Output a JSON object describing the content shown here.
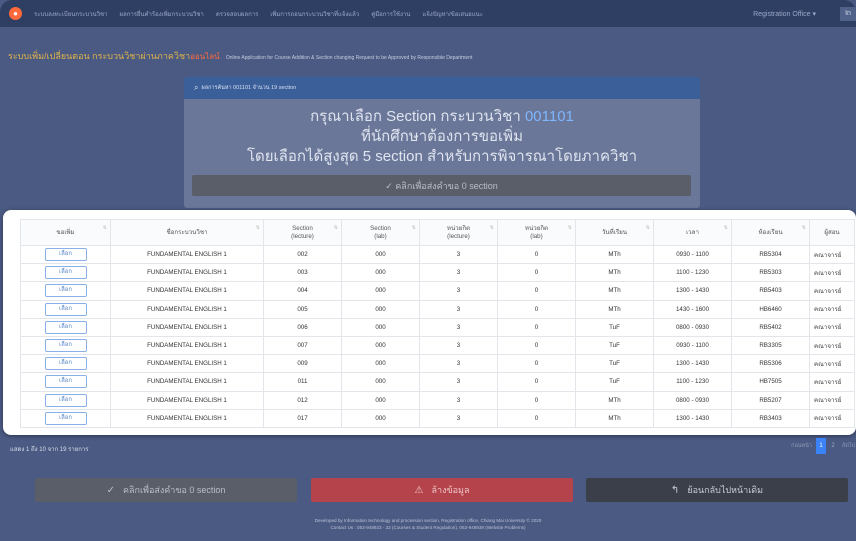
{
  "nav": {
    "items": [
      "ระบบลงทะเบียนกระบวนวิชา",
      "ผลการยื่นคำร้องเพิ่มกระบวนวิชา",
      "ตรวจสอบผลการ",
      "เพิ่มการถอนกระบวนวิชาที่แจ้งแล้ว",
      "คู่มือการใช้งาน",
      "แจ้งปัญหา/ข้อเสนอแนะ"
    ],
    "right_label": "Registration Office ▾",
    "right_box": "In"
  },
  "subtitle": {
    "main": "ระบบเพิ่ม/เปลี่ยนตอน กระบวนวิชาผ่านภาควิชา",
    "highlight": "ออนไลน์",
    "english": "Online Application for Course Addition & Section changing Request to be Approved by Responsible Department"
  },
  "card": {
    "header": "ผลการค้นหา 001101 จำนวน 19 section",
    "line1_prefix": "กรุณาเลือก Section กระบวนวิชา",
    "course_code": "001101",
    "line2": "ที่นักศึกษาต้องการขอเพิ่ม",
    "line3": "โดยเลือกได้สูงสุด 5 section สำหรับการพิจารณาโดยภาควิชา",
    "button": "✓ คลิกเพื่อส่งคำขอ 0 section"
  },
  "table": {
    "headers": [
      "ขอเพิ่ม",
      "ชื่อกระบวนวิชา",
      "Section\n(lecture)",
      "Section\n(lab)",
      "หน่วยกิต\n(lecture)",
      "หน่วยกิต\n(lab)",
      "วันที่เรียน",
      "เวลา",
      "ห้องเรียน",
      "ผู้สอน"
    ],
    "pick_label": "เลือก",
    "rows": [
      {
        "course": "FUNDAMENTAL ENGLISH 1",
        "sec_lec": "002",
        "sec_lab": "000",
        "cr_lec": "3",
        "cr_lab": "0",
        "day": "MTh",
        "time": "0930 - 1100",
        "room": "RB5304",
        "instr": "คณาจารย์"
      },
      {
        "course": "FUNDAMENTAL ENGLISH 1",
        "sec_lec": "003",
        "sec_lab": "000",
        "cr_lec": "3",
        "cr_lab": "0",
        "day": "MTh",
        "time": "1100 - 1230",
        "room": "RB5303",
        "instr": "คณาจารย์"
      },
      {
        "course": "FUNDAMENTAL ENGLISH 1",
        "sec_lec": "004",
        "sec_lab": "000",
        "cr_lec": "3",
        "cr_lab": "0",
        "day": "MTh",
        "time": "1300 - 1430",
        "room": "RB5403",
        "instr": "คณาจารย์"
      },
      {
        "course": "FUNDAMENTAL ENGLISH 1",
        "sec_lec": "005",
        "sec_lab": "000",
        "cr_lec": "3",
        "cr_lab": "0",
        "day": "MTh",
        "time": "1430 - 1600",
        "room": "HB6460",
        "instr": "คณาจารย์"
      },
      {
        "course": "FUNDAMENTAL ENGLISH 1",
        "sec_lec": "006",
        "sec_lab": "000",
        "cr_lec": "3",
        "cr_lab": "0",
        "day": "TuF",
        "time": "0800 - 0930",
        "room": "RB5402",
        "instr": "คณาจารย์"
      },
      {
        "course": "FUNDAMENTAL ENGLISH 1",
        "sec_lec": "007",
        "sec_lab": "000",
        "cr_lec": "3",
        "cr_lab": "0",
        "day": "TuF",
        "time": "0930 - 1100",
        "room": "RB3305",
        "instr": "คณาจารย์"
      },
      {
        "course": "FUNDAMENTAL ENGLISH 1",
        "sec_lec": "009",
        "sec_lab": "000",
        "cr_lec": "3",
        "cr_lab": "0",
        "day": "TuF",
        "time": "1300 - 1430",
        "room": "RB5306",
        "instr": "คณาจารย์"
      },
      {
        "course": "FUNDAMENTAL ENGLISH 1",
        "sec_lec": "011",
        "sec_lab": "000",
        "cr_lec": "3",
        "cr_lab": "0",
        "day": "TuF",
        "time": "1100 - 1230",
        "room": "HB7505",
        "instr": "คณาจารย์"
      },
      {
        "course": "FUNDAMENTAL ENGLISH 1",
        "sec_lec": "012",
        "sec_lab": "000",
        "cr_lec": "3",
        "cr_lab": "0",
        "day": "MTh",
        "time": "0800 - 0930",
        "room": "RB5207",
        "instr": "คณาจารย์"
      },
      {
        "course": "FUNDAMENTAL ENGLISH 1",
        "sec_lec": "017",
        "sec_lab": "000",
        "cr_lec": "3",
        "cr_lab": "0",
        "day": "MTh",
        "time": "1300 - 1430",
        "room": "RB3403",
        "instr": "คณาจารย์"
      }
    ]
  },
  "count_text": "แสดง 1 ถึง 10 จาก 19 รายการ",
  "pager": {
    "prev": "ก่อนหน้า",
    "pages": [
      "1",
      "2"
    ],
    "next": "ถัดไป"
  },
  "buttons": {
    "submit": "คลิกเพื่อส่งคำขอ 0 section",
    "clear": "ล้างข้อมูล",
    "back": "ย้อนกลับไปหน้าเดิม"
  },
  "footer": {
    "line1": "Developed by Information technology and procession section, Registration office, Chiang Mai University © 2020",
    "line2": "Contact Us : 053-948923 - 32 (Courses & Student Regulation), 053-948938 (Website Problems)"
  },
  "colors": {
    "accent": "#3b82f6",
    "danger": "#b5434b",
    "highlight": "#ff6a3d"
  }
}
